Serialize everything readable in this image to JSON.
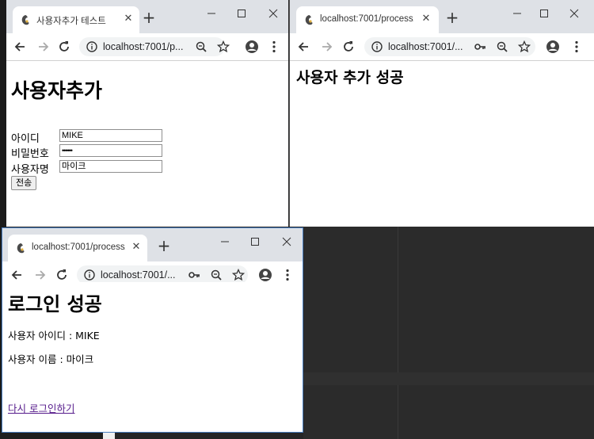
{
  "windows": {
    "add_user": {
      "tab_title": "사용자추가 테스트",
      "url": "localhost:7001/p...",
      "page": {
        "heading": "사용자추가",
        "fields": [
          {
            "label": "아이디",
            "value": "MIKE"
          },
          {
            "label": "비밀번호",
            "value": "••••••"
          },
          {
            "label": "사용자명",
            "value": "마이크"
          }
        ],
        "submit_label": "전송"
      }
    },
    "add_success": {
      "tab_title": "localhost:7001/process/a",
      "url": "localhost:7001/...",
      "page": {
        "heading": "사용자 추가 성공"
      }
    },
    "login_success": {
      "tab_title": "localhost:7001/process/lo",
      "url": "localhost:7001/...",
      "page": {
        "heading": "로그인 성공",
        "user_id_line": "사용자 아이디 : MIKE",
        "user_name_line": "사용자 이름 : 마이크",
        "relogin_link": "다시 로그인하기"
      }
    }
  },
  "colors": {
    "tabbar": "#dee1e6",
    "active_border": "#4a7fc1",
    "visited_link": "#551a8b",
    "desktop": "#252526"
  },
  "icons": [
    "favicon-icon",
    "close-icon",
    "new-tab-icon",
    "minimize-icon",
    "maximize-icon",
    "back-icon",
    "forward-icon",
    "reload-icon",
    "info-icon",
    "key-icon",
    "zoom-icon",
    "star-icon",
    "account-icon",
    "menu-icon"
  ]
}
